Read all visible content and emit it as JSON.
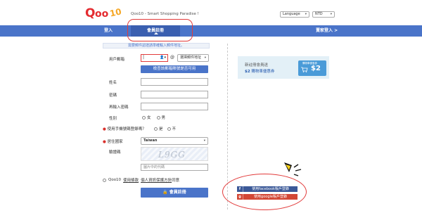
{
  "header": {
    "logo_text": "Qoo10",
    "tagline": "Qoo10 - Smart Shopping Paradise !",
    "language_select": "Language",
    "currency_select": "NTD"
  },
  "nav": {
    "login": "登入",
    "join": "會員註冊",
    "seller": "賣家登入 >"
  },
  "notice": "需要郵件認證請準確輸入郵件地址。",
  "form": {
    "email_label": "用戶郵箱",
    "email_at": "@",
    "domain_select": "選擇郵件地址",
    "check_button": "檢查該郵箱賬號是否可用",
    "name_label": "姓名",
    "password_label": "密碼",
    "password_confirm_label": "再輸入密碼",
    "gender_label": "性別",
    "gender_female": "女",
    "gender_male": "男",
    "phone_label": "使用手機號碼登錄嗎？",
    "phone_yes": "是",
    "phone_no": "不",
    "country_label": "居住國家",
    "country_value": "Taiwan",
    "captcha_label": "驗證碼",
    "captcha_text": "L9GG",
    "captcha_placeholder": "圖片中的代碼",
    "agree_prefix": "Qoo10",
    "agree_terms": "使用條款",
    "agree_privacy": "個人資訊保護方針",
    "agree_suffix": "同意",
    "signup_button": "會員註冊"
  },
  "promo": {
    "line1": "新註冊會員送",
    "line2_amount": "$2",
    "line2_text": "購物車優惠券",
    "coupon_title": "購物車優惠券",
    "coupon_amount": "$2"
  },
  "social": {
    "facebook_icon": "f",
    "facebook_label": "使用facebook賬戶登錄",
    "google_icon": "g",
    "google_label": "使用google賬戶登錄"
  },
  "colors": {
    "nav_blue": "#4a74c9",
    "highlight_red": "#e23b3b",
    "facebook": "#3b5998",
    "google": "#d34836"
  }
}
